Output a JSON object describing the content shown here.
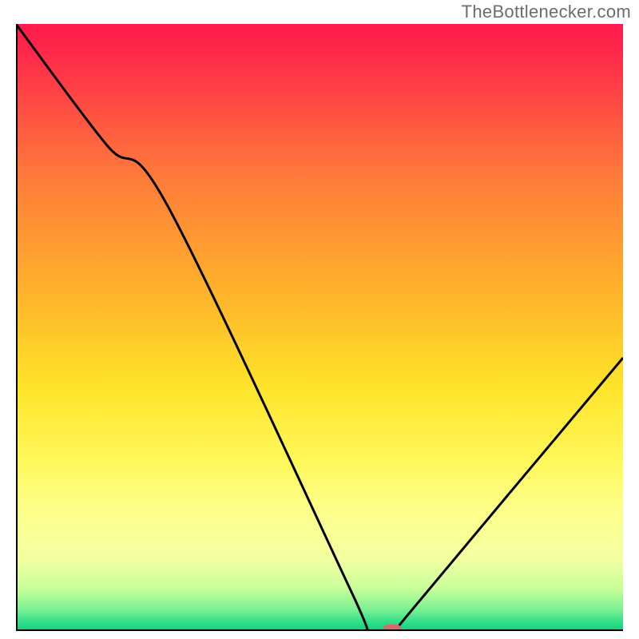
{
  "watermark": "TheBottlenecker.com",
  "chart_data": {
    "type": "line",
    "title": "",
    "xlabel": "",
    "ylabel": "",
    "xlim": [
      0,
      100
    ],
    "ylim": [
      0,
      100
    ],
    "grid": false,
    "series": [
      {
        "name": "curve",
        "x": [
          0,
          15,
          25,
          55,
          58,
          63,
          64,
          100
        ],
        "values": [
          100,
          80,
          70,
          7,
          0,
          0,
          2,
          45
        ]
      }
    ],
    "highlight_marker": {
      "x": 62,
      "y": 0
    },
    "background_gradient": {
      "stops": [
        {
          "pos": 0,
          "color": "#ff1a4b"
        },
        {
          "pos": 0.05,
          "color": "#ff2a4a"
        },
        {
          "pos": 0.25,
          "color": "#ff7a3a"
        },
        {
          "pos": 0.45,
          "color": "#ffb52a"
        },
        {
          "pos": 0.6,
          "color": "#ffe42a"
        },
        {
          "pos": 0.72,
          "color": "#fff85a"
        },
        {
          "pos": 0.8,
          "color": "#fdff8a"
        },
        {
          "pos": 0.88,
          "color": "#f3ffa1"
        },
        {
          "pos": 0.93,
          "color": "#c8ff99"
        },
        {
          "pos": 0.965,
          "color": "#7af092"
        },
        {
          "pos": 0.985,
          "color": "#2fe08a"
        },
        {
          "pos": 1.0,
          "color": "#18c87a"
        }
      ]
    },
    "axes_weight": 4,
    "curve_weight": 3
  }
}
